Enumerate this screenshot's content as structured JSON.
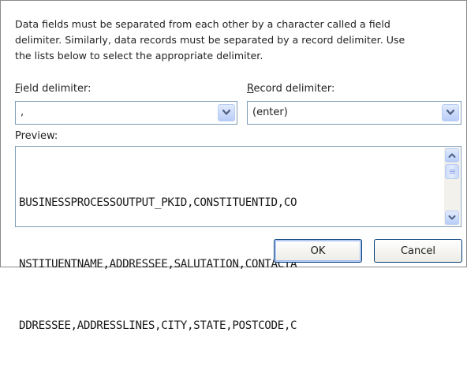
{
  "instructions": {
    "lines": [
      "Data fields must be separated from each other by a character called a field",
      "delimiter. Similarly, data records must be separated by a record delimiter.  Use",
      "the lists below to select the appropriate delimiter."
    ]
  },
  "field_delimiter": {
    "label_key": "F",
    "label_rest": "ield delimiter:",
    "value": ","
  },
  "record_delimiter": {
    "label_key": "R",
    "label_rest": "ecord delimiter:",
    "value": "(enter)"
  },
  "preview": {
    "label": "Preview:",
    "lines": [
      "BUSINESSPROCESSOUTPUT_PKID,CONSTITUENTID,CO",
      "NSTITUENTNAME,ADDRESSEE,SALUTATION,CONTACTA",
      "DDRESSEE,ADDRESSLINES,CITY,STATE,POSTCODE,C"
    ]
  },
  "buttons": {
    "ok": "OK",
    "cancel": "Cancel"
  },
  "icons": {
    "dropdown": "chevron-down-icon",
    "scroll_up": "arrow-up-icon",
    "scroll_down": "arrow-down-icon"
  },
  "colors": {
    "field_border": "#7f9db9",
    "button_border": "#003c74",
    "xp_blue": "#b8cdf7",
    "chevron": "#4d6185"
  }
}
